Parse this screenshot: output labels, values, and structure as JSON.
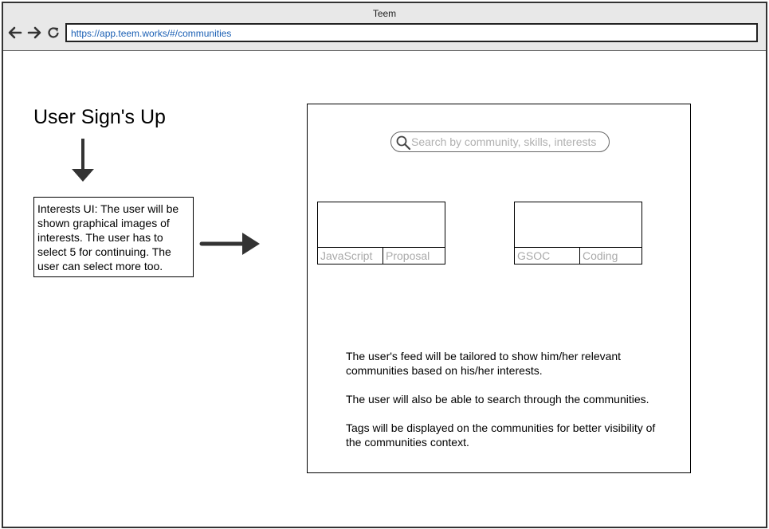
{
  "window": {
    "title": "Teem"
  },
  "address_bar": {
    "url": "https://app.teem.works/#/communities"
  },
  "flow": {
    "heading": "User Sign's Up",
    "description": "Interests UI: The user will be shown graphical images of interests. The user has to select 5 for continuing. The user can select more too."
  },
  "mockup": {
    "search": {
      "placeholder": "Search by community, skills, interests"
    },
    "cards": [
      {
        "tags": [
          "JavaScript",
          "Proposal"
        ]
      },
      {
        "tags": [
          "GSOC",
          "Coding"
        ]
      }
    ],
    "notes": [
      "The user's feed will be tailored to show him/her relevant communities based on his/her interests.",
      "The user will also be able to search through the communities.",
      "Tags will be displayed on the communities for better visibility of the communities context."
    ]
  },
  "icons": [
    "back-arrow-icon",
    "forward-arrow-icon",
    "reload-icon",
    "search-icon",
    "down-arrow-icon",
    "right-arrow-icon"
  ],
  "colors": {
    "url_text": "#1a5fb4",
    "placeholder": "#b0b0b0",
    "tag_text": "#aaaaaa",
    "chrome": "#e8e8e8"
  }
}
